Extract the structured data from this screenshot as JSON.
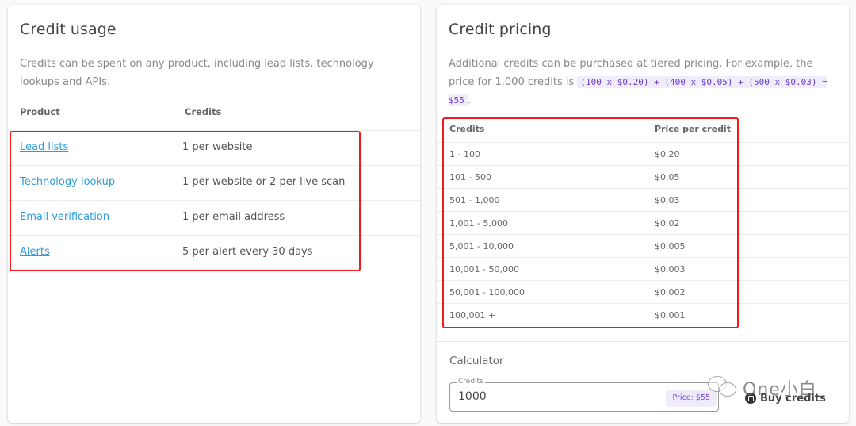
{
  "usage": {
    "title": "Credit usage",
    "description": "Credits can be spent on any product, including lead lists, technology lookups and APIs.",
    "columns": [
      "Product",
      "Credits"
    ],
    "rows": [
      {
        "product": "Lead lists",
        "credits": "1 per website"
      },
      {
        "product": "Technology lookup",
        "credits": "1 per website or 2 per live scan"
      },
      {
        "product": "Email verification",
        "credits": "1 per email address"
      },
      {
        "product": "Alerts",
        "credits": "5 per alert every 30 days"
      }
    ]
  },
  "pricing": {
    "title": "Credit pricing",
    "description_before": "Additional credits can be purchased at tiered pricing. For example, the price for 1,000 credits is ",
    "example_formula": "(100 x $0.20) + (400 x $0.05) + (500 x $0.03) = $55",
    "description_after": ".",
    "columns": [
      "Credits",
      "Price per credit"
    ],
    "rows": [
      {
        "range": "1 - 100",
        "price": "$0.20"
      },
      {
        "range": "101 - 500",
        "price": "$0.05"
      },
      {
        "range": "501 - 1,000",
        "price": "$0.03"
      },
      {
        "range": "1,001 - 5,000",
        "price": "$0.02"
      },
      {
        "range": "5,001 - 10,000",
        "price": "$0.005"
      },
      {
        "range": "10,001 - 50,000",
        "price": "$0.003"
      },
      {
        "range": "50,001 - 100,000",
        "price": "$0.002"
      },
      {
        "range": "100,001 +",
        "price": "$0.001"
      }
    ]
  },
  "calculator": {
    "title": "Calculator",
    "credits_label": "Credits",
    "credits_value": "1000",
    "price_badge": "Price: $55",
    "buy_label": "Buy credits",
    "buy_icon": "cart-icon"
  },
  "watermark": {
    "text": "One小白"
  },
  "colors": {
    "link": "#2d9cdb",
    "accent_purple": "#7b4fd6",
    "highlight_red": "#f21a1a"
  }
}
